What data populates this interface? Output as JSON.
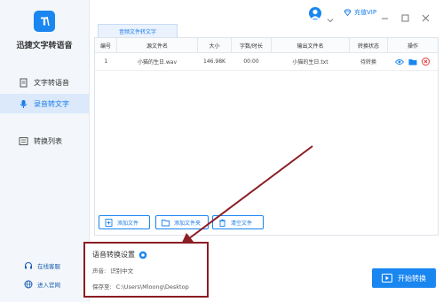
{
  "app": {
    "name": "迅捷文字转语音"
  },
  "sidebar": {
    "items": [
      {
        "label": "文字转语音"
      },
      {
        "label": "录音转文字"
      },
      {
        "label": "转换列表"
      }
    ],
    "bottom": [
      {
        "label": "在线客服"
      },
      {
        "label": "进入官网"
      }
    ]
  },
  "topbar": {
    "vip_label": "充值VIP"
  },
  "tab": {
    "label": "音频文件转文字"
  },
  "table": {
    "headers": [
      "编号",
      "源文件名",
      "大小",
      "字数/时长",
      "输出文件名",
      "转换状态",
      "操作"
    ],
    "rows": [
      {
        "no": "1",
        "source": "小猫的生日.wav",
        "size": "146.98K",
        "duration": "00:00",
        "output": "小猫的生日.txt",
        "status": "待转换"
      }
    ]
  },
  "buttons": {
    "add_file": "添加文件",
    "add_folder": "添加文件夹",
    "clear": "清空文件",
    "start": "开始转换"
  },
  "settings": {
    "title": "语音转换设置",
    "voice_label": "声音:",
    "voice_value": "识别中文",
    "save_label": "保存至:",
    "save_path": "C:\\Users\\Mloong\\Desktop"
  },
  "colors": {
    "accent": "#1a86f0",
    "annotation": "#8c1d24",
    "active_bg": "#dbe9fb"
  }
}
